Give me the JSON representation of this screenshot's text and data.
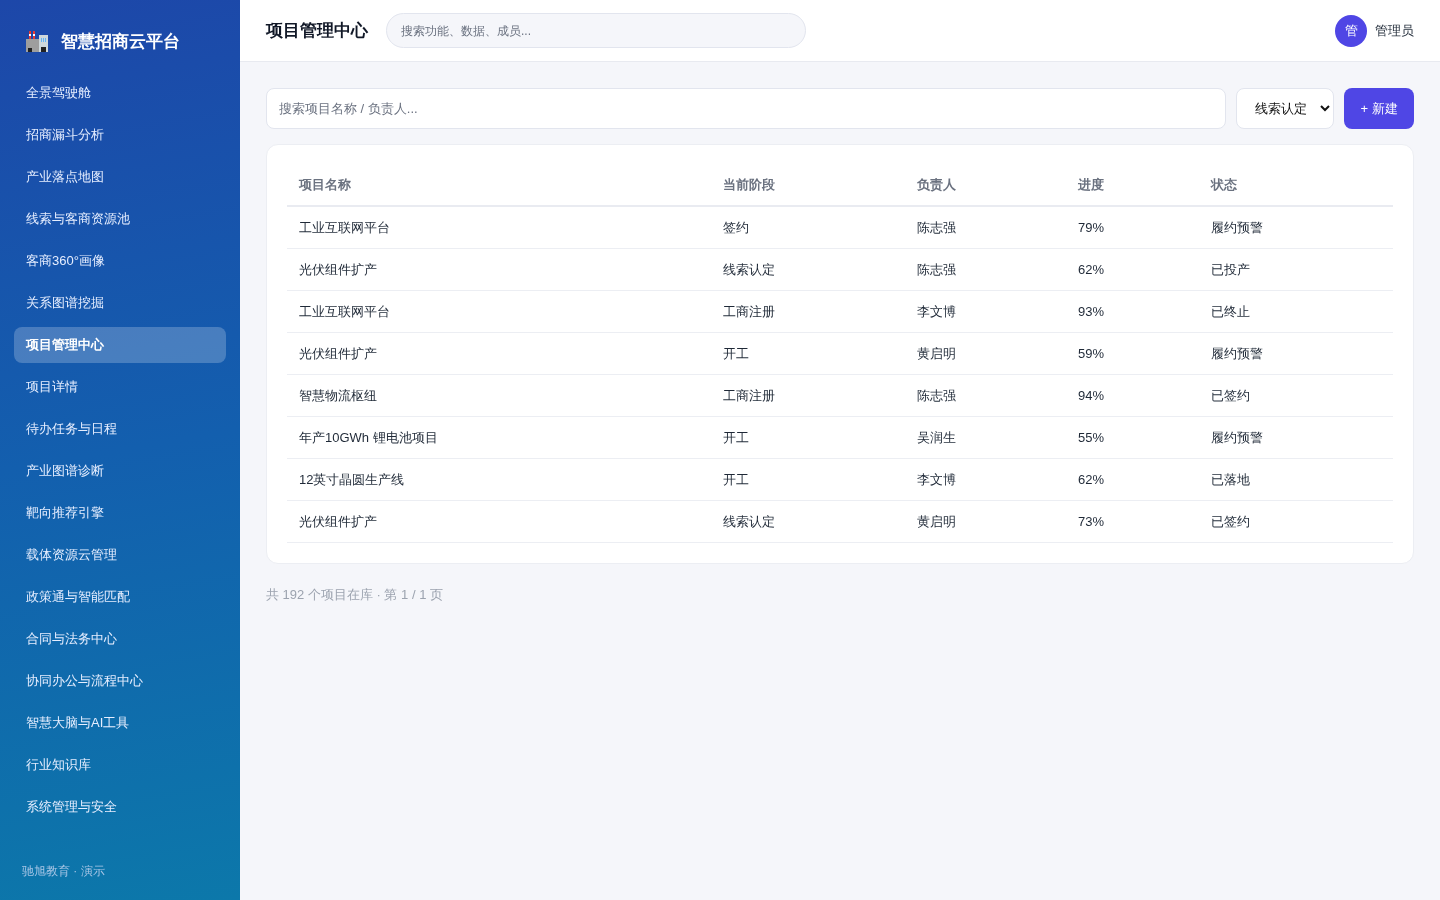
{
  "sidebar": {
    "brand": "智慧招商云平台",
    "items": [
      {
        "label": "全景驾驶舱",
        "selected": false
      },
      {
        "label": "招商漏斗分析",
        "selected": false
      },
      {
        "label": "产业落点地图",
        "selected": false
      },
      {
        "label": "线索与客商资源池",
        "selected": false
      },
      {
        "label": "客商360°画像",
        "selected": false
      },
      {
        "label": "关系图谱挖掘",
        "selected": false
      },
      {
        "label": "项目管理中心",
        "selected": true
      },
      {
        "label": "项目详情",
        "selected": false
      },
      {
        "label": "待办任务与日程",
        "selected": false
      },
      {
        "label": "产业图谱诊断",
        "selected": false
      },
      {
        "label": "靶向推荐引擎",
        "selected": false
      },
      {
        "label": "载体资源云管理",
        "selected": false
      },
      {
        "label": "政策通与智能匹配",
        "selected": false
      },
      {
        "label": "合同与法务中心",
        "selected": false
      },
      {
        "label": "协同办公与流程中心",
        "selected": false
      },
      {
        "label": "智慧大脑与AI工具",
        "selected": false
      },
      {
        "label": "行业知识库",
        "selected": false
      },
      {
        "label": "系统管理与安全",
        "selected": false
      }
    ],
    "footer": "驰旭教育 · 演示"
  },
  "header": {
    "title": "项目管理中心",
    "search": {
      "placeholder": "搜索功能、数据、成员..."
    },
    "user": {
      "avatar_text": "管",
      "name": "管理员"
    }
  },
  "toolbar": {
    "search": {
      "placeholder": "搜索项目名称 / 负责人..."
    },
    "stage_filter": {
      "value": "线索认定"
    },
    "new_button": "+ 新建"
  },
  "table": {
    "columns": [
      "项目名称",
      "当前阶段",
      "负责人",
      "进度",
      "状态"
    ],
    "rows": [
      [
        "工业互联网平台",
        "签约",
        "陈志强",
        "79%",
        "履约预警"
      ],
      [
        "光伏组件扩产",
        "线索认定",
        "陈志强",
        "62%",
        "已投产"
      ],
      [
        "工业互联网平台",
        "工商注册",
        "李文博",
        "93%",
        "已终止"
      ],
      [
        "光伏组件扩产",
        "开工",
        "黄启明",
        "59%",
        "履约预警"
      ],
      [
        "智慧物流枢纽",
        "工商注册",
        "陈志强",
        "94%",
        "已签约"
      ],
      [
        "年产10GWh 锂电池项目",
        "开工",
        "吴润生",
        "55%",
        "履约预警"
      ],
      [
        "12英寸晶圆生产线",
        "开工",
        "李文博",
        "62%",
        "已落地"
      ],
      [
        "光伏组件扩产",
        "线索认定",
        "黄启明",
        "73%",
        "已签约"
      ]
    ]
  },
  "summary": "共 192 个项目在库 · 第 1 / 1 页"
}
